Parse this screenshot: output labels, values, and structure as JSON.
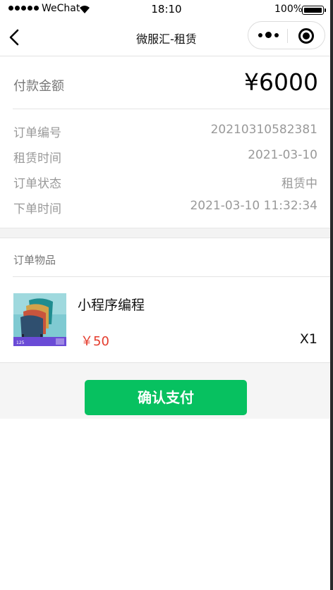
{
  "status_bar": {
    "carrier": "WeChat",
    "time": "18:10",
    "battery": "100%",
    "battery_level": 1.0,
    "signal_icon": "signal-dots-icon",
    "wifi_icon": "wifi-icon"
  },
  "nav": {
    "title": "微服汇-租赁",
    "back_icon": "back-arrow-icon",
    "more_icon": "more-dots-icon",
    "close_icon": "target-circle-icon"
  },
  "payment": {
    "label": "付款金额",
    "amount": "¥6000"
  },
  "order_info": [
    {
      "key": "订单编号",
      "value": "20210310582381"
    },
    {
      "key": "租赁时间",
      "value": "2021-03-10"
    },
    {
      "key": "订单状态",
      "value": "租赁中"
    },
    {
      "key": "下单时间",
      "value": "2021-03-10 11:32:34"
    }
  ],
  "items_section": {
    "title": "订单物品"
  },
  "product": {
    "name": "小程序编程",
    "price": "￥50",
    "quantity": "X1",
    "thumb_badge": "125"
  },
  "footer": {
    "pay_button": "确认支付"
  },
  "colors": {
    "accent": "#07c160",
    "price": "#e43b2c"
  }
}
